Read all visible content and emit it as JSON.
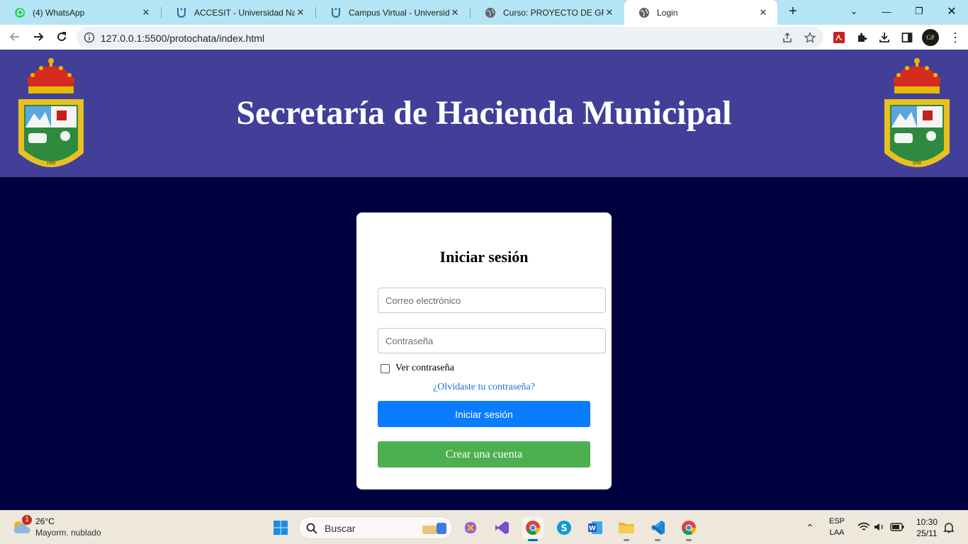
{
  "browser": {
    "tabs": [
      {
        "title": "(4) WhatsApp",
        "icon": "whatsapp-icon"
      },
      {
        "title": "ACCESIT - Universidad Nacional",
        "icon": "university-icon"
      },
      {
        "title": "Campus Virtual - Universidad",
        "icon": "university-icon"
      },
      {
        "title": "Curso: PROYECTO DE GRADO",
        "icon": "globe-icon"
      },
      {
        "title": "Login",
        "icon": "globe-icon"
      }
    ],
    "active_tab": 4,
    "url": "127.0.0.1:5500/protochata/index.html",
    "profile_initials": "GP"
  },
  "page": {
    "banner_title": "Secretaría de Hacienda Municipal",
    "banner_color": "#413f98",
    "background_color": "#000040",
    "login": {
      "title": "Iniciar sesión",
      "email_placeholder": "Correo electrónico",
      "password_placeholder": "Contraseña",
      "show_password_label": "Ver contraseña",
      "forgot_link": "¿Olvidaste tu contraseña?",
      "login_button": "Iniciar sesión",
      "create_button": "Crear una cuenta",
      "login_color": "#0a7cff",
      "create_color": "#4caf50"
    }
  },
  "taskbar": {
    "weather_temp": "26°C",
    "weather_desc": "Mayorm. nublado",
    "weather_badge": "1",
    "search_label": "Buscar",
    "lang": "ESP",
    "layout": "LAA",
    "time": "10:30",
    "date": "25/11"
  }
}
